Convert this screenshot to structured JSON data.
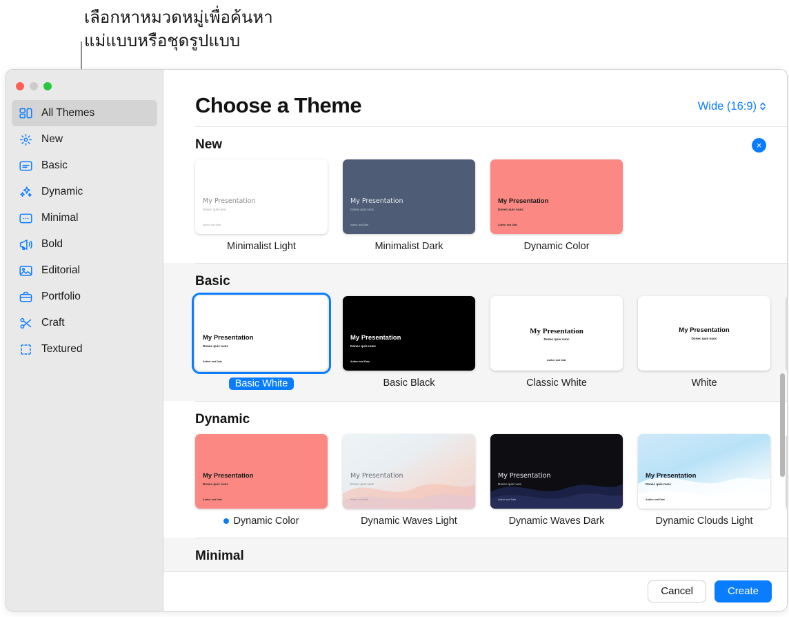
{
  "callout": {
    "text": "เลือกหาหมวดหมู่เพื่อค้นหา\nแม่แบบหรือชุดรูปแบบ"
  },
  "colors": {
    "accent": "#0a7dff",
    "sidebar_bg": "#e9e9e9",
    "band_shaded": "#f5f5f5",
    "traffic_red": "#ff5f57",
    "traffic_yellow": "#ccccca",
    "traffic_green": "#28c840"
  },
  "window": {
    "traffic_lights": [
      "close",
      "minimize",
      "zoom"
    ]
  },
  "sidebar": {
    "items": [
      {
        "label": "All Themes",
        "icon": "all-themes-icon",
        "active": true
      },
      {
        "label": "New",
        "icon": "sparkle-rays-icon",
        "active": false
      },
      {
        "label": "Basic",
        "icon": "basic-card-icon",
        "active": false
      },
      {
        "label": "Dynamic",
        "icon": "sparkles-icon",
        "active": false
      },
      {
        "label": "Minimal",
        "icon": "minimal-dots-icon",
        "active": false
      },
      {
        "label": "Bold",
        "icon": "megaphone-icon",
        "active": false
      },
      {
        "label": "Editorial",
        "icon": "photo-icon",
        "active": false
      },
      {
        "label": "Portfolio",
        "icon": "briefcase-icon",
        "active": false
      },
      {
        "label": "Craft",
        "icon": "scissors-icon",
        "active": false
      },
      {
        "label": "Textured",
        "icon": "crop-frame-icon",
        "active": false
      }
    ]
  },
  "header": {
    "title": "Choose a Theme",
    "aspect_ratio": "Wide (16:9)",
    "aspect_chevron": "⌃⌄"
  },
  "slide_text": {
    "title": "My Presentation",
    "subtitle": "Donec quis nunc",
    "author": "Author and Date"
  },
  "sections": [
    {
      "title": "New",
      "shaded": false,
      "dismissible": true,
      "close_label": "×",
      "themes": [
        {
          "name": "Minimalist Light",
          "selected": false,
          "dot": false,
          "clipped": false
        },
        {
          "name": "Minimalist Dark",
          "selected": false,
          "dot": false,
          "clipped": false
        },
        {
          "name": "Dynamic Color",
          "selected": false,
          "dot": false,
          "clipped": false
        }
      ]
    },
    {
      "title": "Basic",
      "shaded": true,
      "dismissible": false,
      "themes": [
        {
          "name": "Basic White",
          "selected": true,
          "dot": false,
          "clipped": false
        },
        {
          "name": "Basic Black",
          "selected": false,
          "dot": false,
          "clipped": false
        },
        {
          "name": "Classic White",
          "selected": false,
          "dot": false,
          "clipped": false
        },
        {
          "name": "White",
          "selected": false,
          "dot": false,
          "clipped": false
        },
        {
          "name": "",
          "selected": false,
          "dot": false,
          "clipped": true
        }
      ]
    },
    {
      "title": "Dynamic",
      "shaded": false,
      "dismissible": false,
      "themes": [
        {
          "name": "Dynamic Color",
          "selected": false,
          "dot": true,
          "clipped": false
        },
        {
          "name": "Dynamic Waves Light",
          "selected": false,
          "dot": false,
          "clipped": false
        },
        {
          "name": "Dynamic Waves Dark",
          "selected": false,
          "dot": false,
          "clipped": false
        },
        {
          "name": "Dynamic Clouds Light",
          "selected": false,
          "dot": false,
          "clipped": false
        },
        {
          "name": "",
          "selected": false,
          "dot": false,
          "clipped": true
        }
      ]
    },
    {
      "title": "Minimal",
      "shaded": true,
      "dismissible": false,
      "themes": []
    }
  ],
  "footer": {
    "cancel_label": "Cancel",
    "create_label": "Create"
  }
}
